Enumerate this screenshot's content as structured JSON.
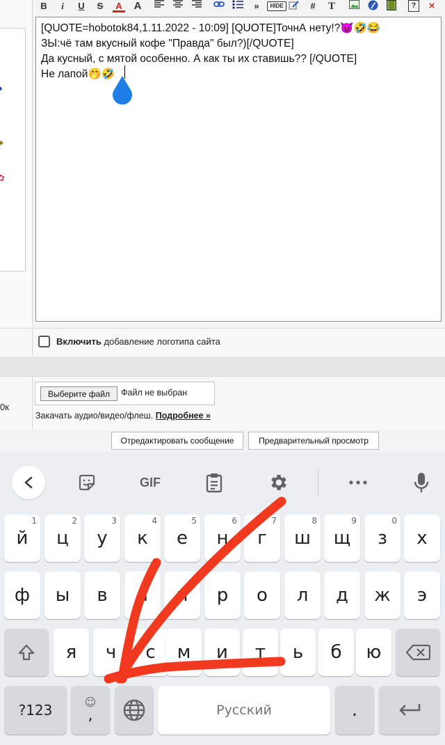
{
  "editor": {
    "lines": [
      "[QUOTE=hobotok84,1.11.2022 - 10:09] [QUOTE]ТочнА нету!?😈🤣😂",
      "ЗЫ:чё там вкусный кофе \"Правда\" был?)[/QUOTE]",
      "Да кусный, с мятой особенно. А как ты их ставишь?? [/QUOTE]",
      "Не лапой🤭🤣"
    ]
  },
  "toolbar": {
    "bold": "B",
    "italic": "i",
    "underline": "U",
    "strike": "S",
    "color": "A",
    "size": "A",
    "quote": "»",
    "hide": "HIDE",
    "hash": "#",
    "text": "T",
    "help": "?",
    "close": "×"
  },
  "logo_option": {
    "bold_label": "Включить",
    "label": " добавление логотипа сайта"
  },
  "file_upload": {
    "left_fragment": "0к",
    "button_label": "Выберите файл",
    "status": "Файл не выбран",
    "upload_text": "Закачать аудио/видео/флеш. ",
    "more_link": "Подробнее »"
  },
  "actions": {
    "edit_label": "Отредактировать сообщение",
    "preview_label": "Предварительный просмотр"
  },
  "keyboard": {
    "suggestions": {
      "gif_label": "GIF"
    },
    "row1": [
      {
        "char": "й",
        "hint": "1"
      },
      {
        "char": "ц",
        "hint": "2"
      },
      {
        "char": "у",
        "hint": "3"
      },
      {
        "char": "к",
        "hint": "4"
      },
      {
        "char": "е",
        "hint": "5"
      },
      {
        "char": "н",
        "hint": "6"
      },
      {
        "char": "г",
        "hint": "7"
      },
      {
        "char": "ш",
        "hint": "8"
      },
      {
        "char": "щ",
        "hint": "9"
      },
      {
        "char": "з",
        "hint": "0"
      },
      {
        "char": "х",
        "hint": ""
      }
    ],
    "row2": [
      "ф",
      "ы",
      "в",
      "а",
      "п",
      "р",
      "о",
      "л",
      "д",
      "ж",
      "э"
    ],
    "row3": [
      "я",
      "ч",
      "с",
      "м",
      "и",
      "т",
      "ь",
      "б",
      "ю"
    ],
    "sym_label": "?123",
    "comma_top": "☺",
    "comma_label": ",",
    "space_label": "Русский",
    "period_label": "."
  },
  "colors": {
    "annotation": "#f0391e",
    "drop": "#1e7ee6"
  }
}
